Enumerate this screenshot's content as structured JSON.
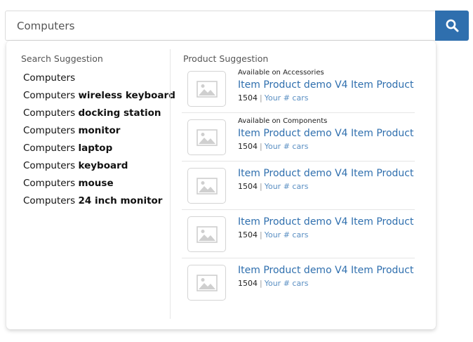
{
  "search": {
    "value": "Computers",
    "button_icon": "search-icon",
    "button_color": "#2f6fae"
  },
  "search_suggestions": {
    "title": "Search Suggestion",
    "items": [
      {
        "prefix": "Computers",
        "bold": ""
      },
      {
        "prefix": "Computers",
        "bold": "wireless keyboard"
      },
      {
        "prefix": "Computers",
        "bold": "docking station"
      },
      {
        "prefix": "Computers",
        "bold": "monitor"
      },
      {
        "prefix": "Computers",
        "bold": "laptop"
      },
      {
        "prefix": "Computers",
        "bold": "keyboard"
      },
      {
        "prefix": "Computers",
        "bold": "mouse"
      },
      {
        "prefix": "Computers",
        "bold": "24 inch monitor"
      }
    ]
  },
  "product_suggestions": {
    "title": "Product Suggestion",
    "items": [
      {
        "availability": "Available on Accessories",
        "title": "Item Product demo V4 Item Product",
        "number": "1504",
        "separator": "|",
        "link": "Your # cars",
        "image_icon": "image-placeholder-icon"
      },
      {
        "availability": "Available on Components",
        "title": "Item Product demo V4 Item Product",
        "number": "1504",
        "separator": "|",
        "link": "Your # cars",
        "image_icon": "image-placeholder-icon"
      },
      {
        "availability": "",
        "title": "Item Product demo V4 Item Product",
        "number": "1504",
        "separator": "|",
        "link": "Your # cars",
        "image_icon": "image-placeholder-icon"
      },
      {
        "availability": "",
        "title": "Item Product demo V4 Item Product",
        "number": "1504",
        "separator": "|",
        "link": "Your # cars",
        "image_icon": "image-placeholder-icon"
      },
      {
        "availability": "",
        "title": "Item Product demo V4 Item Product",
        "number": "1504",
        "separator": "|",
        "link": "Your # cars",
        "image_icon": "image-placeholder-icon"
      }
    ]
  },
  "colors": {
    "accent": "#2f6fae",
    "link_light": "#5a8fc3",
    "divider": "#e6e6e6"
  }
}
